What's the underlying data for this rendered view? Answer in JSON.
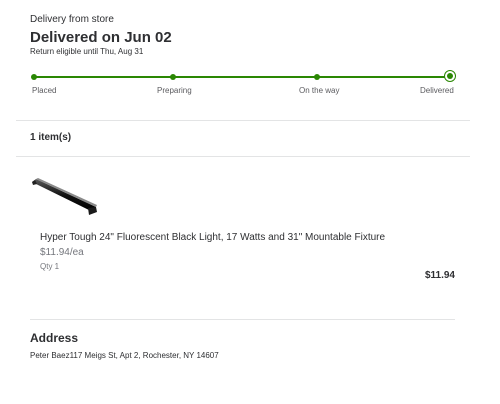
{
  "order": {
    "delivery_mode": "Delivery from store",
    "status_title": "Delivered on Jun 02",
    "return_note": "Return eligible until Thu, Aug 31"
  },
  "tracker": {
    "color": "#2a8703",
    "steps": [
      {
        "label": "Placed"
      },
      {
        "label": "Preparing"
      },
      {
        "label": "On the way"
      },
      {
        "label": "Delivered"
      }
    ]
  },
  "items": {
    "count_label": "1 item(s)",
    "list": [
      {
        "image_icon": "black-light-fixture-image",
        "name": "Hyper Tough 24\" Fluorescent Black Light, 17 Watts and 31\" Mountable Fixture",
        "price_each": "$11.94/ea",
        "quantity": "Qty 1",
        "total": "$11.94"
      }
    ]
  },
  "address": {
    "title": "Address",
    "text": "Peter Baez117 Meigs St, Apt 2, Rochester, NY 14607"
  }
}
